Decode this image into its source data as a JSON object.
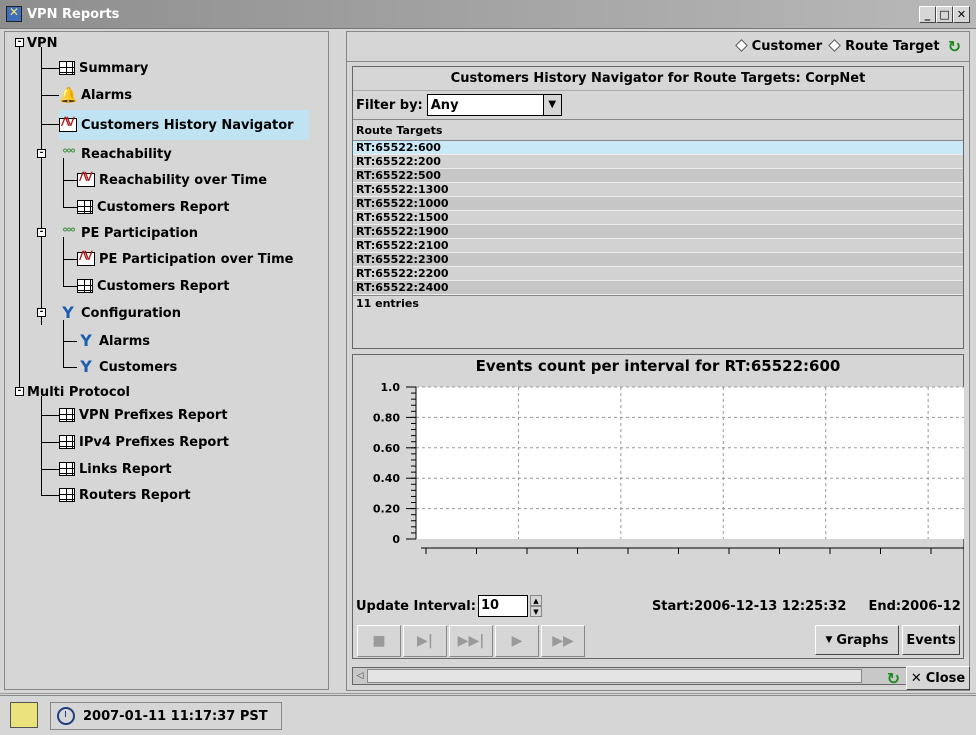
{
  "window": {
    "title": "VPN Reports",
    "buttons": {
      "minimize": "_",
      "maximize": "□",
      "close": "✕"
    }
  },
  "tree": {
    "vpn_label": "VPN",
    "summary": "Summary",
    "alarms": "Alarms",
    "customers_history_navigator": "Customers History Navigator",
    "reachability": "Reachability",
    "reachability_over_time": "Reachability over Time",
    "reachability_customers_report": "Customers Report",
    "pe_participation": "PE Participation",
    "pe_participation_over_time": "PE Participation over Time",
    "pe_customers_report": "Customers Report",
    "configuration": "Configuration",
    "config_alarms": "Alarms",
    "config_customers": "Customers",
    "multi_protocol": "Multi Protocol",
    "vpn_prefixes_report": "VPN Prefixes Report",
    "ipv4_prefixes_report": "IPv4 Prefixes Report",
    "links_report": "Links Report",
    "routers_report": "Routers Report",
    "selected": "customers_history_navigator"
  },
  "modebar": {
    "customer_label": "Customer",
    "route_target_label": "Route Target"
  },
  "navigator": {
    "title": "Customers History Navigator for Route Targets: CorpNet",
    "filter_label": "Filter by:",
    "filter_value": "Any",
    "column_header": "Route Targets",
    "rows": [
      "RT:65522:600",
      "RT:65522:200",
      "RT:65522:500",
      "RT:65522:1300",
      "RT:65522:1000",
      "RT:65522:1500",
      "RT:65522:1900",
      "RT:65522:2100",
      "RT:65522:2300",
      "RT:65522:2200",
      "RT:65522:2400"
    ],
    "selected_index": 0,
    "entries_text": "11 entries"
  },
  "chart_data": {
    "type": "line",
    "title": "Events count per interval for RT:65522:600",
    "xlabel": "",
    "ylabel": "",
    "ylim": [
      0,
      1.0
    ],
    "yticks": [
      "1.0",
      "0.80",
      "0.60",
      "0.40",
      "0.20",
      "0"
    ],
    "series": [],
    "grid": true
  },
  "playback": {
    "update_interval_label": "Update Interval:",
    "update_interval_value": "10",
    "start_text": "Start:2006-12-13 12:25:32",
    "end_text": "End:2006-12",
    "controls": [
      "■",
      "▶|",
      "▶▶|",
      "▶",
      "▶▶"
    ],
    "graphs_label": "Graphs",
    "events_label": "Events"
  },
  "footer": {
    "close_label": "Close"
  },
  "status": {
    "timestamp": "2007-01-11 11:17:37 PST"
  },
  "colors": {
    "selection": "#bfe3f3",
    "refresh": "#1c8a1c"
  }
}
